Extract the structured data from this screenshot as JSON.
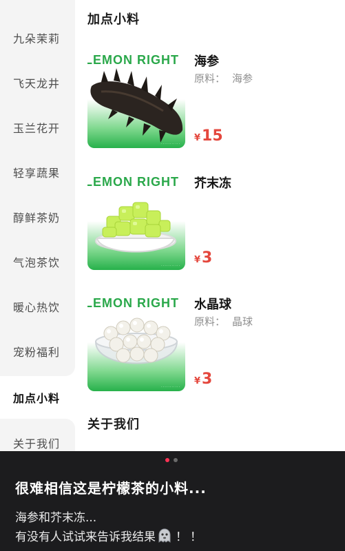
{
  "sidebar": {
    "items": [
      {
        "label": "九朵茉莉"
      },
      {
        "label": "飞天龙井"
      },
      {
        "label": "玉兰花开"
      },
      {
        "label": "轻享蔬果"
      },
      {
        "label": "醇鲜茶奶"
      },
      {
        "label": "气泡茶饮"
      },
      {
        "label": "暖心热饮"
      },
      {
        "label": "宠粉福利"
      },
      {
        "label": "加点小料",
        "active": true
      },
      {
        "label": "关于我们"
      }
    ]
  },
  "main": {
    "section_title": "加点小料",
    "next_section_title": "关于我们",
    "products": [
      {
        "brand": "LEMON RIGHT",
        "name": "海参",
        "origin_label": "原料：",
        "origin_value": "海参",
        "currency": "¥",
        "price": "15",
        "image_icon": "sea-cucumber"
      },
      {
        "brand": "LEMON RIGHT",
        "name": "芥末冻",
        "origin_label": "",
        "origin_value": "",
        "currency": "¥",
        "price": "3",
        "image_icon": "wasabi-jelly-bowl"
      },
      {
        "brand": "LEMON RIGHT",
        "name": "水晶球",
        "origin_label": "原料：",
        "origin_value": "晶球",
        "currency": "¥",
        "price": "3",
        "image_icon": "crystal-balls-bowl"
      }
    ]
  },
  "caption": {
    "title": "很难相信这是柠檬茶的小料...",
    "line1": "海参和芥末冻...",
    "line2": "有没有人试试来告诉我结果",
    "line2_suffix": "！！",
    "emoji_icon": "ghost-face-emoji",
    "page_dots": {
      "count": 2,
      "active": 1
    }
  },
  "colors": {
    "price": "#e4473d",
    "brand_green": "#2aa84a",
    "sidebar_bg": "#f4f4f4",
    "overlay_bg": "#1c1c1e",
    "active_dot": "#ff3355"
  }
}
